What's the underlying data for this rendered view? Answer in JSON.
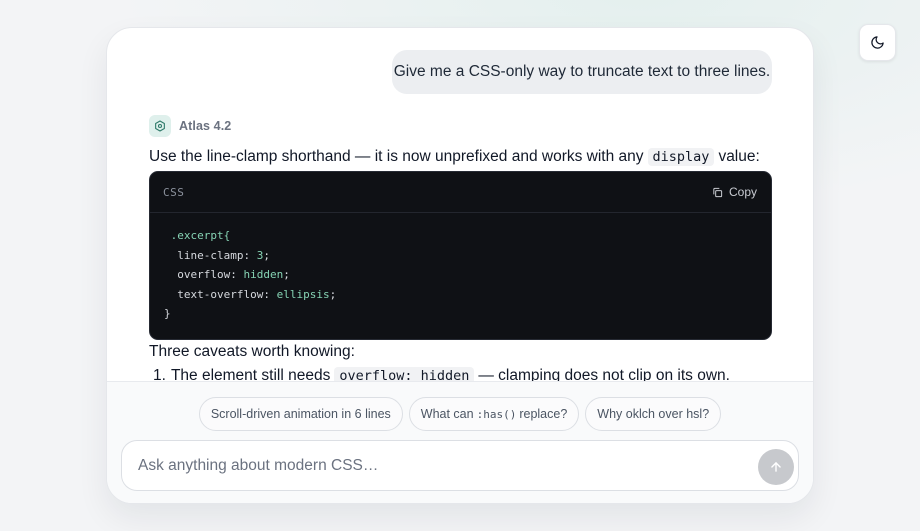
{
  "colors": {
    "accent": "#86d3b4",
    "send_button": "#c7c9cd",
    "code_bg": "#0f1115"
  },
  "theme_toggle": {
    "icon": "moon-icon"
  },
  "user_message": "Give me a CSS-only way to truncate text to three lines.",
  "assistant": {
    "icon": "hexagon-icon",
    "name": "Atlas 4.2",
    "intro_before": "Use the line-clamp shorthand — it is now unprefixed and works with any",
    "intro_code": "display",
    "intro_after": "value:",
    "code_block": {
      "language": "CSS",
      "copy_label": "Copy",
      "copy_icon": "copy-icon",
      "lines": [
        {
          "indent": " ",
          "a": ".excerpt{",
          "b": "",
          "c": ""
        },
        {
          "indent": "  ",
          "a": "line-clamp: ",
          "b": "3",
          "c": ";"
        },
        {
          "indent": "  ",
          "a": "overflow: ",
          "b": "hidden",
          "c": ";"
        },
        {
          "indent": "  ",
          "a": "text-overflow: ",
          "b": "ellipsis",
          "c": ";"
        },
        {
          "indent": "",
          "a": "}",
          "b": "",
          "c": ""
        }
      ]
    },
    "followup": "Three caveats worth knowing:",
    "caveats": [
      {
        "number": "1.",
        "text_before": "The element still needs",
        "code": "overflow: hidden",
        "text_after": "— clamping does not clip on its own."
      }
    ]
  },
  "suggestions": [
    {
      "before": "Scroll-driven animation in 6 lines",
      "code": "",
      "after": ""
    },
    {
      "before": "What can",
      "code": ":has()",
      "after": "replace?"
    },
    {
      "before": "Why oklch over hsl?",
      "code": "",
      "after": ""
    }
  ],
  "composer": {
    "placeholder": "Ask anything about modern CSS…",
    "send_icon": "arrow-up-icon"
  }
}
